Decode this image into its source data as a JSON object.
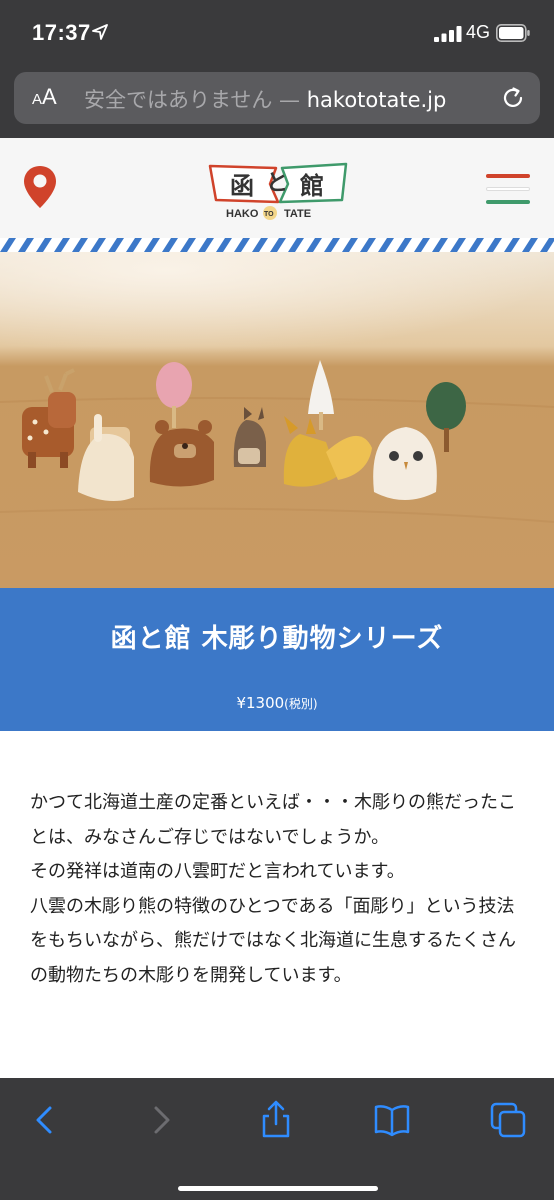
{
  "status_bar": {
    "time": "17:37",
    "network": "4G"
  },
  "url_bar": {
    "text_size_label": "AA",
    "security_warning": "安全ではありません",
    "separator": " — ",
    "domain": "hakototate.jp"
  },
  "site": {
    "logo": {
      "left_glyph": "函",
      "middle_glyph": "と",
      "right_glyph": "館",
      "romaji_left": "HAKO",
      "romaji_to": "TO",
      "romaji_right": "TATE"
    },
    "brand_colors": {
      "accent_red": "#d0432b",
      "accent_green": "#3f9a6b",
      "title_blue": "#3c78c8"
    }
  },
  "product": {
    "title": "函と館 木彫り動物シリーズ",
    "price": "¥1300",
    "tax_note": "(税別)"
  },
  "description": [
    "かつて北海道土産の定番といえば・・・木彫りの熊だったことは、みなさんご存じではないでしょうか。",
    "その発祥は道南の八雲町だと言われています。",
    "八雲の木彫り熊の特徴のひとつである「面彫り」という技法をもちいながら、熊だけではなく北海道に生息するたくさんの動物たちの木彫りを開発しています。"
  ],
  "icons": {
    "location": "location-pin-icon",
    "menu": "hamburger-menu-icon",
    "reload": "reload-icon",
    "back": "back-arrow-icon",
    "forward": "forward-arrow-icon",
    "share": "share-icon",
    "bookmarks": "bookmarks-book-icon",
    "tabs": "tabs-icon"
  }
}
